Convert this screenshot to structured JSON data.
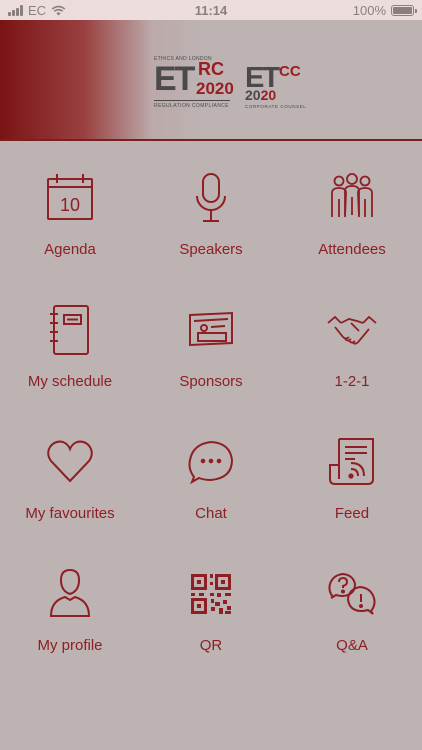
{
  "status_bar": {
    "carrier": "EC",
    "time": "11:14",
    "battery": "100%"
  },
  "header": {
    "logo_etrc": {
      "top": "ETHICS AND LONDON",
      "main": "ET",
      "suffix": "RC",
      "year": "2020",
      "subtitle": "REGULATION COMPLIANCE"
    },
    "logo_etcc": {
      "main": "ET",
      "suffix": "CC",
      "year_a": "20",
      "year_b": "20",
      "subtitle": "CORPORATE COUNSEL"
    }
  },
  "menu": {
    "items": [
      {
        "label": "Agenda",
        "icon": "calendar-icon",
        "calendar_day": "10"
      },
      {
        "label": "Speakers",
        "icon": "microphone-icon"
      },
      {
        "label": "Attendees",
        "icon": "people-icon"
      },
      {
        "label": "My schedule",
        "icon": "notebook-icon"
      },
      {
        "label": "Sponsors",
        "icon": "business-card-icon"
      },
      {
        "label": "1-2-1",
        "icon": "handshake-icon"
      },
      {
        "label": "My favourites",
        "icon": "heart-icon"
      },
      {
        "label": "Chat",
        "icon": "chat-bubble-icon"
      },
      {
        "label": "Feed",
        "icon": "newspaper-feed-icon"
      },
      {
        "label": "My profile",
        "icon": "user-icon"
      },
      {
        "label": "QR",
        "icon": "qr-code-icon"
      },
      {
        "label": "Q&A",
        "icon": "question-answer-icon"
      }
    ]
  },
  "colors": {
    "accent": "#8e1f24",
    "background": "#bdb3b3",
    "status_bar": "#ecdcdc"
  }
}
